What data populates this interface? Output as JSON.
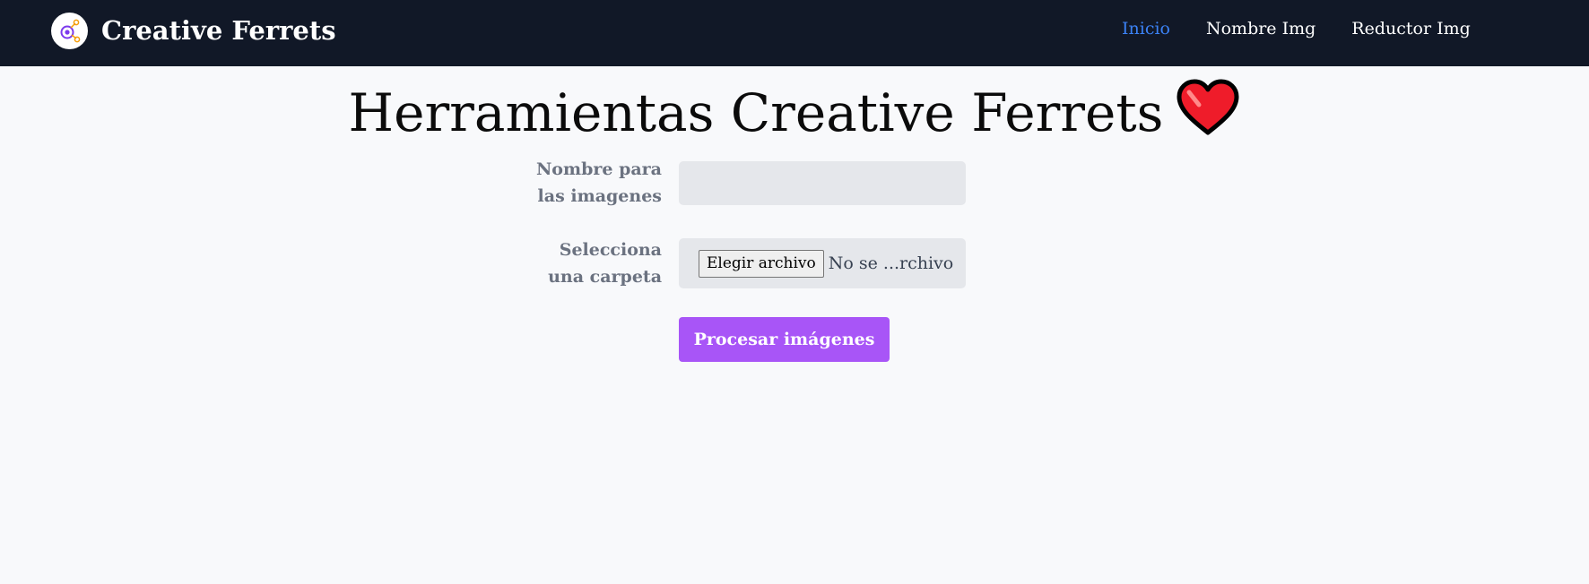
{
  "navbar": {
    "brand": "Creative Ferrets",
    "links": [
      {
        "label": "Inicio",
        "active": true
      },
      {
        "label": "Nombre Img",
        "active": false
      },
      {
        "label": "Reductor Img",
        "active": false
      }
    ],
    "background_color": "#111827",
    "active_link_color": "#3b82f6"
  },
  "main": {
    "title": "Herramientas Creative Ferrets",
    "title_icon": "red-heart-icon"
  },
  "form": {
    "name_label_line1": "Nombre para",
    "name_label_line2": "las imagenes",
    "name_value": "",
    "folder_label_line1": "Selecciona",
    "folder_label_line2": "una carpeta",
    "file_button_label": "Elegir archivo",
    "file_status": "No se ...rchivo",
    "submit_label": "Procesar imágenes",
    "submit_color": "#a855f7"
  }
}
